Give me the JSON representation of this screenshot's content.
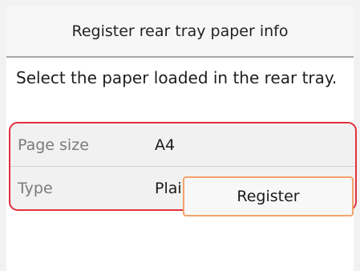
{
  "header": {
    "title": "Register rear tray paper info"
  },
  "instruction": "Select the paper loaded in the rear tray.",
  "settings": [
    {
      "label": "Page size",
      "value": "A4"
    },
    {
      "label": "Type",
      "value": "Plain paper"
    }
  ],
  "actions": {
    "register_label": "Register"
  },
  "colors": {
    "highlight_border": "#e2313e",
    "button_border": "#f3a36b",
    "header_divider": "#a8a8a8"
  }
}
